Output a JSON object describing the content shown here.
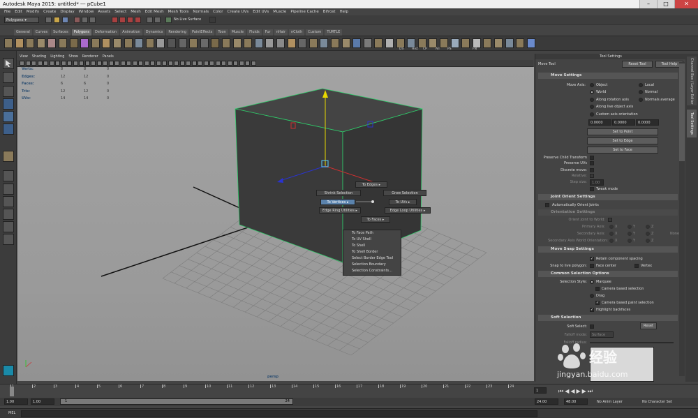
{
  "window": {
    "title": "Autodesk Maya 2015: untitled*  ---  pCube1",
    "minimize_icon": "–",
    "maximize_icon": "□",
    "close_icon": "✕"
  },
  "menus": [
    "File",
    "Edit",
    "Modify",
    "Create",
    "Display",
    "Window",
    "Assets",
    "Select",
    "Mesh",
    "Edit Mesh",
    "Mesh Tools",
    "Normals",
    "Color",
    "Create UVs",
    "Edit UVs",
    "Muscle",
    "Pipeline Cache",
    "Bifrost",
    "Help"
  ],
  "status_line": {
    "mode": "Polygons",
    "live_surface": "No Live Surface"
  },
  "shelf_tabs": [
    "General",
    "Curves",
    "Surfaces",
    "Polygons",
    "Deformation",
    "Animation",
    "Dynamics",
    "Rendering",
    "PaintEffects",
    "Toon",
    "Muscle",
    "Fluids",
    "Fur",
    "nHair",
    "nCloth",
    "Custom",
    "TURTLE"
  ],
  "shelf_active": "Polygons",
  "shelf_labels": [
    "DS",
    "Hist",
    "CP",
    "All",
    "PS",
    "FN"
  ],
  "viewport": {
    "menus": [
      "View",
      "Shading",
      "Lighting",
      "Show",
      "Renderer",
      "Panels"
    ],
    "camera": "persp",
    "hud": [
      {
        "label": "Verts:",
        "v1": "8",
        "v2": "8",
        "v3": "0"
      },
      {
        "label": "Edges:",
        "v1": "12",
        "v2": "12",
        "v3": "0"
      },
      {
        "label": "Faces:",
        "v1": "6",
        "v2": "6",
        "v3": "0"
      },
      {
        "label": "Tris:",
        "v1": "12",
        "v2": "12",
        "v3": "0"
      },
      {
        "label": "UVs:",
        "v1": "14",
        "v2": "14",
        "v3": "0"
      }
    ]
  },
  "marking_menu": {
    "to_edges": "To Edges",
    "shrink": "Shrink Selection",
    "grow": "Grow Selection",
    "to_vertices": "To Vertices",
    "to_uvs": "To UVs",
    "edge_ring": "Edge Ring Utilities",
    "edge_loop": "Edge Loop Utilities",
    "to_faces": "To Faces",
    "arrow": "▸",
    "submenu": [
      "To Face Path",
      "To UV Shell",
      "To Shell",
      "To Shell Border",
      "Select Border Edge Tool",
      "Selection Boundary",
      "Selection Constraints..."
    ]
  },
  "timeline": {
    "ticks": [
      "1",
      "2",
      "3",
      "4",
      "5",
      "6",
      "7",
      "8",
      "9",
      "10",
      "11",
      "12",
      "13",
      "14",
      "15",
      "16",
      "17",
      "18",
      "19",
      "20",
      "21",
      "22",
      "23",
      "24"
    ],
    "current_frame": "1",
    "end_frame": "1",
    "range_start": "1.00",
    "range_start2": "1.00",
    "range_in": "1",
    "range_out": "24",
    "range_end": "24.00",
    "range_end2": "48.00",
    "anim_layer": "No Anim Layer",
    "char_set": "No Character Set",
    "cmd_label": "MEL"
  },
  "tool_settings": {
    "header": "Tool Settings",
    "tool_name": "Move Tool",
    "reset_tool": "Reset Tool",
    "tool_help": "Tool Help",
    "move_settings": "Move Settings",
    "move_axis_label": "Move Axis:",
    "axis_options": [
      {
        "label": "Object",
        "on": false
      },
      {
        "label": "Local",
        "on": false
      },
      {
        "label": "World",
        "on": true
      },
      {
        "label": "Normal",
        "on": false
      },
      {
        "label": "Along rotation axis",
        "on": false
      },
      {
        "label": "Normals average",
        "on": false
      },
      {
        "label": "Along live object axis",
        "on": false
      },
      {
        "label": "Custom axis orientation",
        "on": false
      }
    ],
    "custom_vals": [
      "0.0000",
      "0.0000",
      "0.0000"
    ],
    "set_to_point": "Set to Point",
    "set_to_edge": "Set to Edge",
    "set_to_face": "Set to Face",
    "preserve_child": "Preserve Child Transform",
    "preserve_uvs": "Preserve UVs",
    "discrete_move": "Discrete move:",
    "relative": "Relative:",
    "step_size": "Step size:",
    "step_value": "1.00",
    "tweak_mode": "Tweak mode",
    "joint_orient": "Joint Orient Settings",
    "auto_orient": "Automatically Orient Joints",
    "orientation_settings": "Orientation Settings",
    "orient_joint_world": "Orient Joint to World:",
    "primary_axis": "Primary Axis:",
    "secondary_axis": "Secondary Axis:",
    "secondary_world": "Secondary Axis World Orientation:",
    "axis_letters": [
      "X",
      "Y",
      "Z"
    ],
    "none_label": "None",
    "move_snap": "Move Snap Settings",
    "retain_spacing": "Retain component spacing",
    "snap_live": "Snap to live polygon:",
    "face_center": "Face center",
    "vertex": "Vertex",
    "common_sel": "Common Selection Options",
    "selection_style": "Selection Style:",
    "marquee": "Marquee",
    "camera_based": "Camera based selection",
    "drag": "Drag",
    "camera_paint": "Camera based paint selection",
    "highlight_back": "Highlight backfaces",
    "soft_selection": "Soft Selection",
    "soft_select": "Soft Select:",
    "reset": "Reset",
    "falloff_mode": "Falloff mode:",
    "falloff_mode_val": "Surface",
    "falloff_radius": "Falloff radius:",
    "side_tabs": [
      "Channel Box / Layer Editor",
      "Tool Settings"
    ]
  },
  "watermark": {
    "brand": "Baidu",
    "cn": "经验",
    "url": "jingyan.baidu.com"
  },
  "colors": {
    "accent": "#5b83ad",
    "cube_face": "#3b3b3b",
    "cube_edge": "#2fcc6a",
    "y_axis": "#e8d800",
    "x_axis": "#d03030",
    "z_axis": "#2a33d0"
  }
}
